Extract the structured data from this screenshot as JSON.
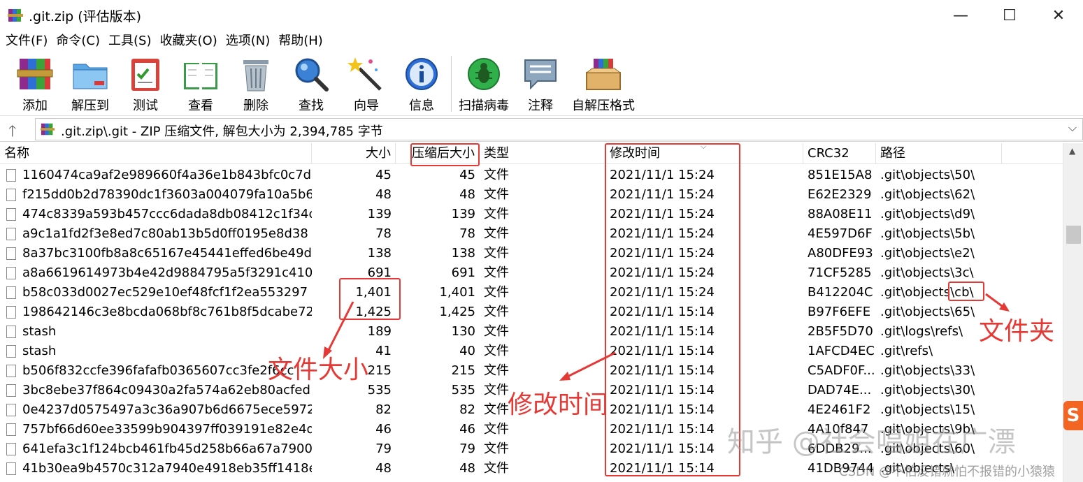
{
  "window": {
    "title": ".git.zip (评估版本)",
    "min_glyph": "—",
    "max_glyph": "☐",
    "close_glyph": "✕"
  },
  "menu": [
    "文件(F)",
    "命令(C)",
    "工具(S)",
    "收藏夹(O)",
    "选项(N)",
    "帮助(H)"
  ],
  "toolbar": [
    {
      "label": "添加",
      "icon": "add-archive-icon"
    },
    {
      "label": "解压到",
      "icon": "extract-folder-icon"
    },
    {
      "label": "测试",
      "icon": "test-clipboard-icon"
    },
    {
      "label": "查看",
      "icon": "view-book-icon"
    },
    {
      "label": "删除",
      "icon": "trash-icon"
    },
    {
      "label": "查找",
      "icon": "magnifier-icon"
    },
    {
      "label": "向导",
      "icon": "wizard-wand-icon"
    },
    {
      "label": "信息",
      "icon": "info-icon"
    },
    {
      "label": "扫描病毒",
      "icon": "virus-scan-icon"
    },
    {
      "label": "注释",
      "icon": "comment-icon"
    },
    {
      "label": "自解压格式",
      "icon": "sfx-box-icon"
    }
  ],
  "address": {
    "text": ".git.zip\\.git - ZIP 压缩文件, 解包大小为 2,394,785 字节",
    "up_glyph": "🡑",
    "dropdown_glyph": "⌵"
  },
  "columns": {
    "name": "名称",
    "size": "大小",
    "packed": "压缩后大小",
    "type": "类型",
    "modified": "修改时间",
    "crc": "CRC32",
    "path": "路径"
  },
  "rows": [
    {
      "name": "1160474ca9af2e989660f4a36e1b843bfc0c7d",
      "size": "45",
      "packed": "45",
      "type": "文件",
      "modified": "2021/11/1 15:24",
      "crc": "851E15A8",
      "path": ".git\\objects\\50\\"
    },
    {
      "name": "f215dd0b2d78390dc1f3603a004079fa10a5b6",
      "size": "48",
      "packed": "48",
      "type": "文件",
      "modified": "2021/11/1 15:24",
      "crc": "E62E2329",
      "path": ".git\\objects\\62\\"
    },
    {
      "name": "474c8339a593b457ccc6dada8db08412c1f34c",
      "size": "139",
      "packed": "139",
      "type": "文件",
      "modified": "2021/11/1 15:24",
      "crc": "88A08E11",
      "path": ".git\\objects\\d9\\"
    },
    {
      "name": "a9c1a1fd2f3e8ed7c80ab13b5d0ff0195e8d38",
      "size": "78",
      "packed": "78",
      "type": "文件",
      "modified": "2021/11/1 15:24",
      "crc": "4E597D6F",
      "path": ".git\\objects\\5b\\"
    },
    {
      "name": "8a37bc3100fb8a8c65167e45441effed6be49d",
      "size": "138",
      "packed": "138",
      "type": "文件",
      "modified": "2021/11/1 15:24",
      "crc": "A80DFE93",
      "path": ".git\\objects\\e2\\"
    },
    {
      "name": "a8a6619614973b4e42d9884795a5f3291c4103",
      "size": "691",
      "packed": "691",
      "type": "文件",
      "modified": "2021/11/1 15:24",
      "crc": "71CF5285",
      "path": ".git\\objects\\3c\\"
    },
    {
      "name": "b58c033d0027ec529e10ef48fcf1f2ea553297",
      "size": "1,401",
      "packed": "1,401",
      "type": "文件",
      "modified": "2021/11/1 15:24",
      "crc": "B412204C",
      "path": ".git\\objects\\cb\\"
    },
    {
      "name": "198642146c3e8bcda068bf8c761b8f5dcabe72",
      "size": "1,425",
      "packed": "1,425",
      "type": "文件",
      "modified": "2021/11/1 15:14",
      "crc": "B97F6EFE",
      "path": ".git\\objects\\65\\"
    },
    {
      "name": "stash",
      "size": "189",
      "packed": "130",
      "type": "文件",
      "modified": "2021/11/1 15:14",
      "crc": "2B5F5D70",
      "path": ".git\\logs\\refs\\"
    },
    {
      "name": "stash",
      "size": "41",
      "packed": "40",
      "type": "文件",
      "modified": "2021/11/1 15:14",
      "crc": "1AFCD4EC",
      "path": ".git\\refs\\"
    },
    {
      "name": "b506f832ccfe396fafafb0365607cc3fe2f6cc",
      "size": "215",
      "packed": "215",
      "type": "文件",
      "modified": "2021/11/1 15:14",
      "crc": "C5ADF0F...",
      "path": ".git\\objects\\33\\"
    },
    {
      "name": "3bc8ebe37f864c09430a2fa574a62eb80acfed",
      "size": "535",
      "packed": "535",
      "type": "文件",
      "modified": "2021/11/1 15:14",
      "crc": "DAD74E...",
      "path": ".git\\objects\\30\\"
    },
    {
      "name": "0e4237d0575497a3c36a907b6d6675ece59725",
      "size": "82",
      "packed": "82",
      "type": "文件",
      "modified": "2021/11/1 15:14",
      "crc": "4E2461F2",
      "path": ".git\\objects\\15\\"
    },
    {
      "name": "757bf66d60ee33599b904397ff039191e82e4d",
      "size": "46",
      "packed": "46",
      "type": "文件",
      "modified": "2021/11/1 15:14",
      "crc": "4A10f847",
      "path": ".git\\objects\\9b\\"
    },
    {
      "name": "641efa3c1f124bcb461fb45d258b66a67a7900",
      "size": "79",
      "packed": "79",
      "type": "文件",
      "modified": "2021/11/1 15:14",
      "crc": "6DDB29...",
      "path": ".git\\objects\\60\\"
    },
    {
      "name": "41b30ea9b4570c312a7940e4918eb35ff1418e",
      "size": "48",
      "packed": "48",
      "type": "文件",
      "modified": "2021/11/1 15:14",
      "crc": "41DB9744",
      "path": ".git\\objects\\"
    }
  ],
  "annotations": {
    "file_size": "文件大小",
    "modified_time": "修改时间",
    "folder": "文件夹",
    "accent_color": "#e53935"
  },
  "watermarks": {
    "zhihu": "知乎 @社会唱姐在广漂",
    "csdn": "CSDN @不怕没错就怕不报错的小猿猿"
  },
  "tray": {
    "sogou": "S"
  }
}
